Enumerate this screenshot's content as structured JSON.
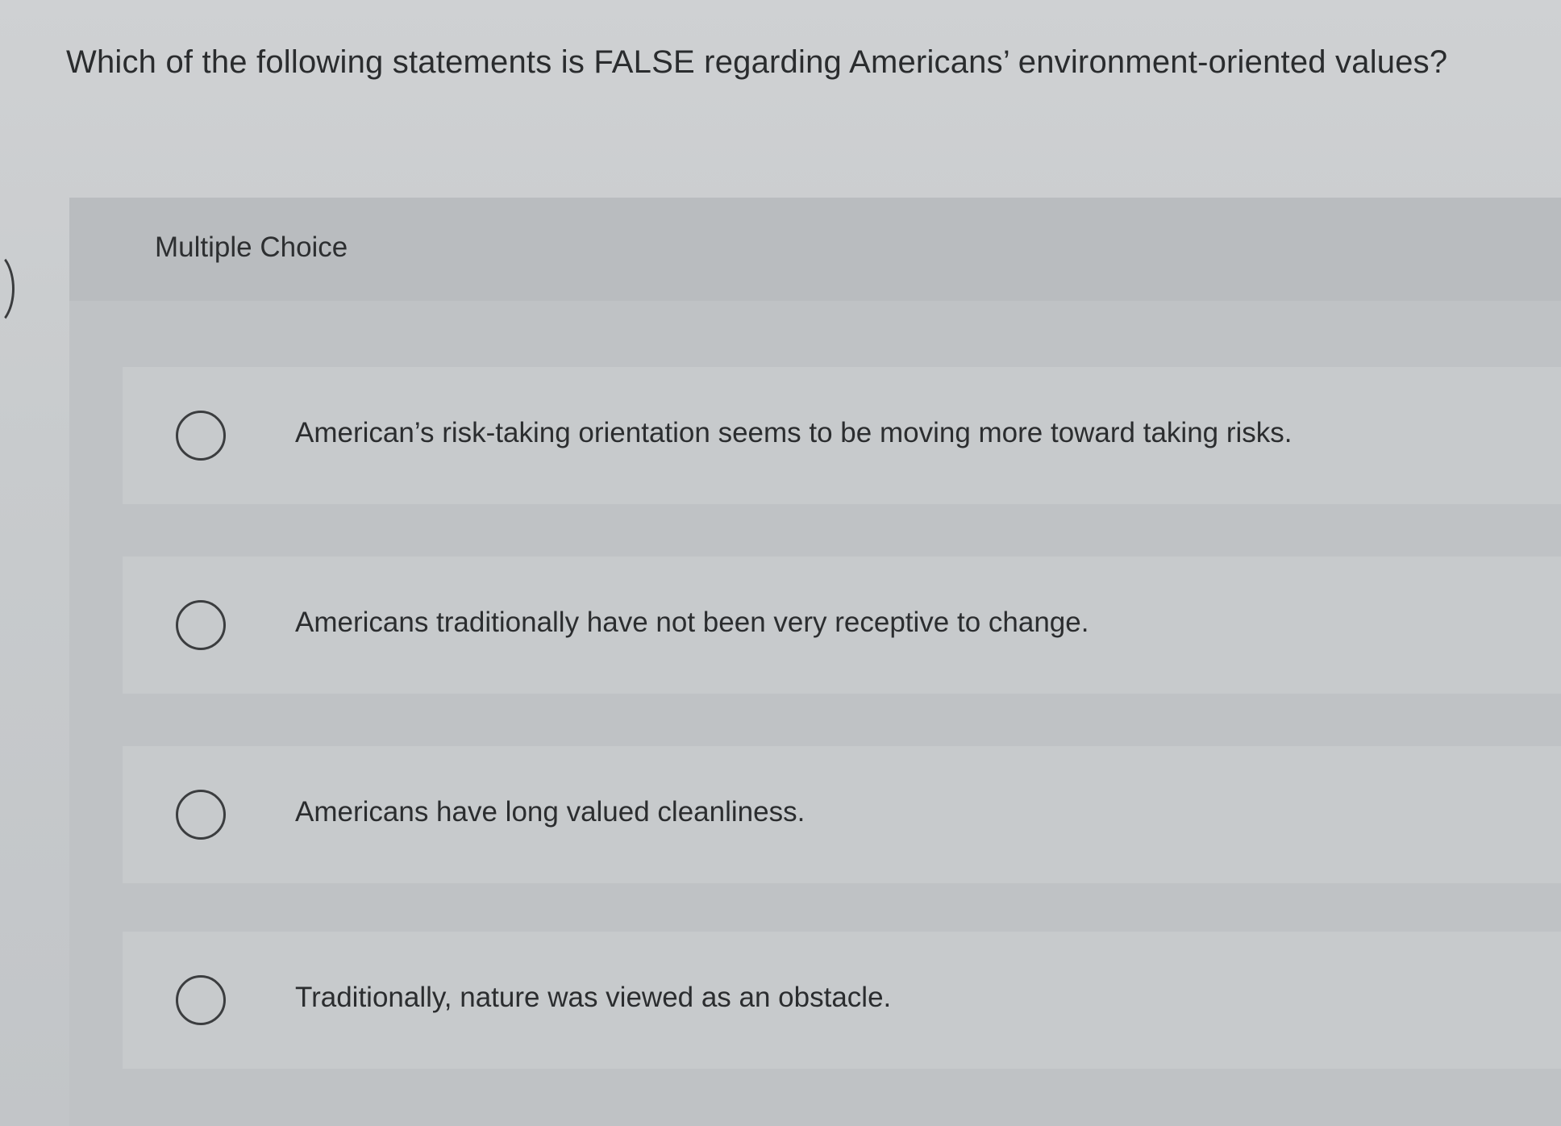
{
  "question": {
    "text": "Which of the following statements is FALSE regarding Americans’ environment-oriented values?"
  },
  "panel": {
    "type_label": "Multiple Choice"
  },
  "options": [
    {
      "label": "American’s risk-taking orientation seems to be moving more toward taking risks.",
      "selected": false
    },
    {
      "label": "Americans traditionally have not been very receptive to change.",
      "selected": false
    },
    {
      "label": "Americans have long valued cleanliness.",
      "selected": false
    },
    {
      "label": "Traditionally, nature was viewed as an obstacle.",
      "selected": false
    }
  ],
  "icons": {
    "radio": "radio-unselected-icon"
  }
}
